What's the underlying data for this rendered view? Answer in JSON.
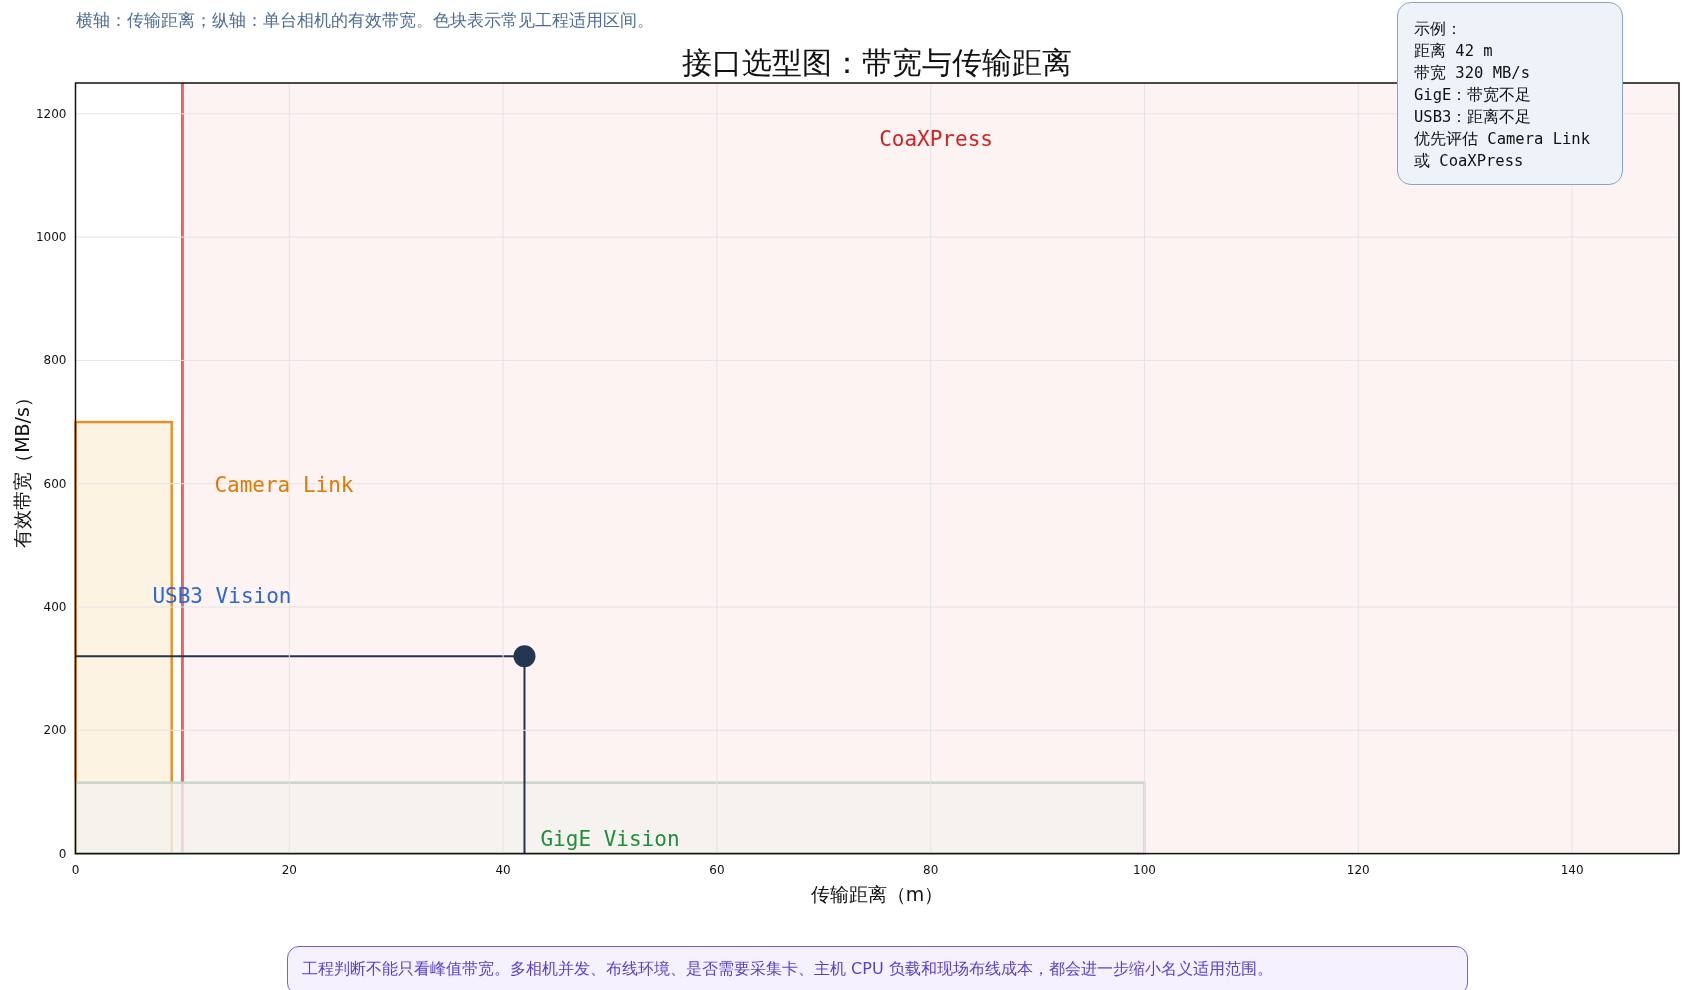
{
  "caption": "横轴：传输距离；纵轴：单台相机的有效带宽。色块表示常见工程适用区间。",
  "chart_data": {
    "type": "scatter",
    "title": "接口选型图：带宽与传输距离",
    "xlabel": "传输距离（m）",
    "ylabel": "有效带宽（MB/s）",
    "x": [
      42
    ],
    "values": [
      320
    ],
    "xlim": [
      0,
      150
    ],
    "ylim": [
      0,
      1250
    ],
    "grid": true,
    "xticks": [
      0,
      20,
      40,
      60,
      80,
      100,
      120,
      140
    ],
    "yticks": [
      0,
      200,
      400,
      600,
      800,
      1000,
      1200
    ],
    "annotations": [
      "CoaXPress",
      "Camera Link",
      "USB3 Vision",
      "GigE Vision"
    ]
  },
  "callout": [
    "示例：",
    "距离 42 m",
    "带宽 320 MB/s",
    "GigE：带宽不足",
    "USB3：距离不足",
    "优先评估 Camera Link",
    "或 CoaXPress"
  ],
  "note": "工程判断不能只看峰值带宽。多相机并发、布线环境、是否需要采集卡、主机 CPU 负载和现场布线成本，都会进一步缩小名义适用范围。"
}
